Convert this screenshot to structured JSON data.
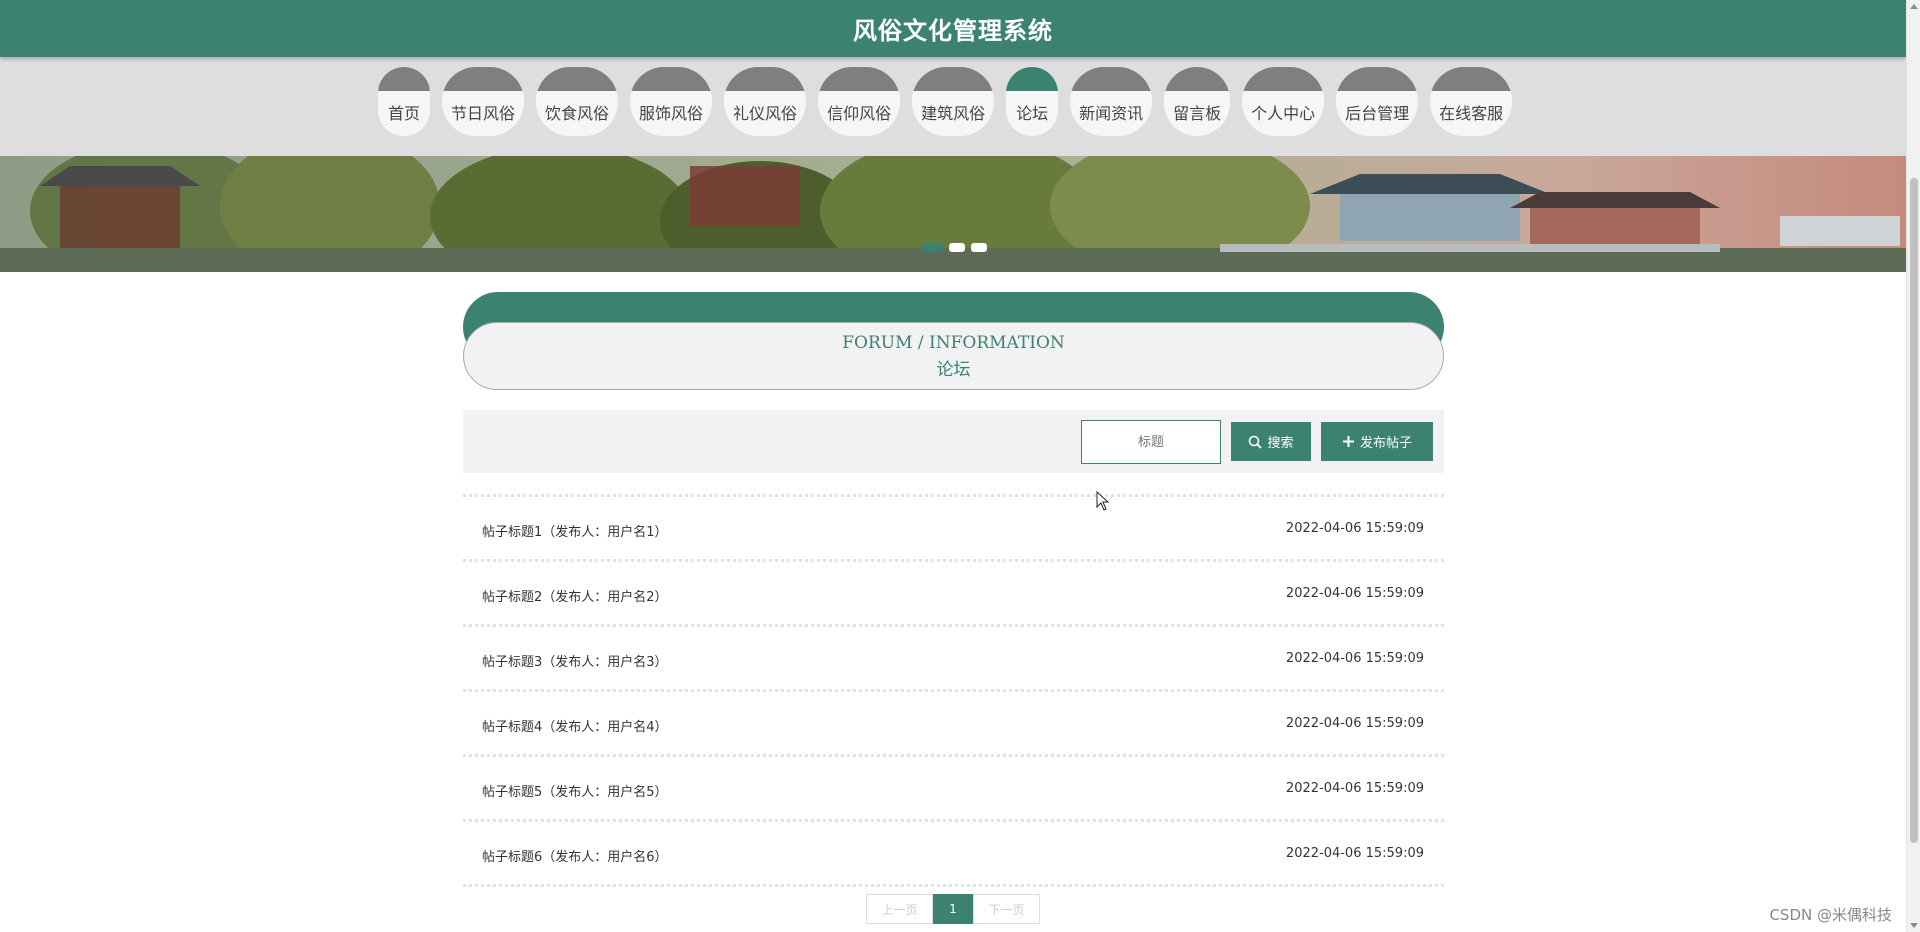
{
  "header": {
    "title": "风俗文化管理系统"
  },
  "nav": {
    "items": [
      {
        "label": "首页",
        "active": false
      },
      {
        "label": "节日风俗",
        "active": false
      },
      {
        "label": "饮食风俗",
        "active": false
      },
      {
        "label": "服饰风俗",
        "active": false
      },
      {
        "label": "礼仪风俗",
        "active": false
      },
      {
        "label": "信仰风俗",
        "active": false
      },
      {
        "label": "建筑风俗",
        "active": false
      },
      {
        "label": "论坛",
        "active": true
      },
      {
        "label": "新闻资讯",
        "active": false
      },
      {
        "label": "留言板",
        "active": false
      },
      {
        "label": "个人中心",
        "active": false
      },
      {
        "label": "后台管理",
        "active": false
      },
      {
        "label": "在线客服",
        "active": false
      }
    ]
  },
  "banner": {
    "slides": 3,
    "active_slide": 1
  },
  "section": {
    "title_en": "FORUM / INFORMATION",
    "title_cn": "论坛"
  },
  "search": {
    "placeholder": "标题",
    "value": "",
    "search_label": "搜索",
    "publish_label": "发布帖子"
  },
  "posts": [
    {
      "title": "帖子标题1（发布人：用户名1）",
      "time": "2022-04-06 15:59:09"
    },
    {
      "title": "帖子标题2（发布人：用户名2）",
      "time": "2022-04-06 15:59:09"
    },
    {
      "title": "帖子标题3（发布人：用户名3）",
      "time": "2022-04-06 15:59:09"
    },
    {
      "title": "帖子标题4（发布人：用户名4）",
      "time": "2022-04-06 15:59:09"
    },
    {
      "title": "帖子标题5（发布人：用户名5）",
      "time": "2022-04-06 15:59:09"
    },
    {
      "title": "帖子标题6（发布人：用户名6）",
      "time": "2022-04-06 15:59:09"
    }
  ],
  "pagination": {
    "prev_label": "上一页",
    "current_page": "1",
    "next_label": "下一页"
  },
  "watermark": "CSDN @米偶科技",
  "colors": {
    "primary": "#3c8270",
    "nav_cap": "#7f7f7f",
    "nav_bar": "#dedede",
    "panel": "#f2f1f4"
  }
}
